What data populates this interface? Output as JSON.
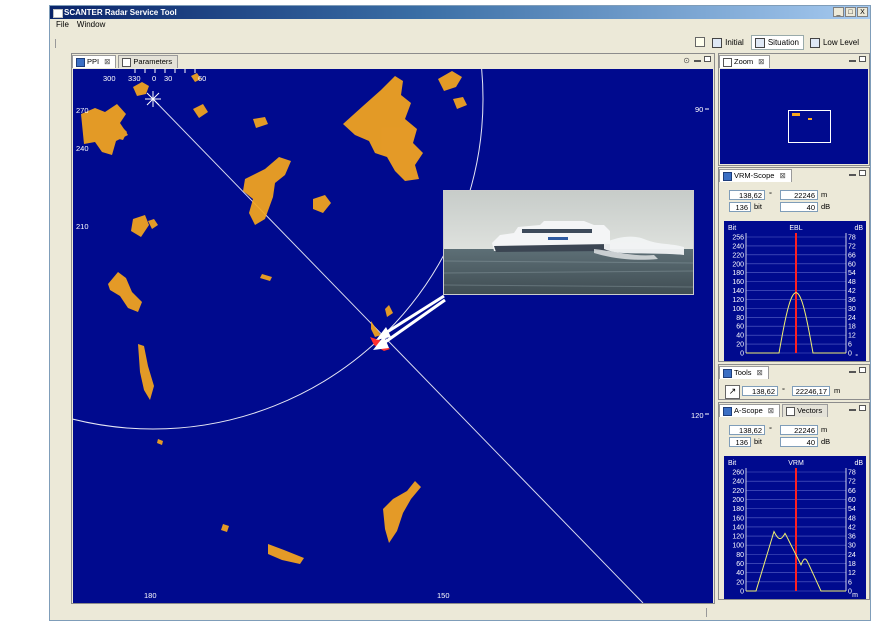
{
  "window": {
    "title": "SCANTER Radar Service Tool",
    "buttons": {
      "minimize": "_",
      "maximize": "□",
      "close": "X"
    }
  },
  "menu": [
    "File",
    "Window"
  ],
  "perspectives": [
    {
      "label": "Initial",
      "active": false
    },
    {
      "label": "Situation",
      "active": true
    },
    {
      "label": "Low Level",
      "active": false
    }
  ],
  "ppi": {
    "tabs": [
      {
        "label": "PPI",
        "close": "⊠"
      },
      {
        "label": "Parameters"
      }
    ],
    "bearing_labels": {
      "300": "300",
      "330": "330",
      "0": "0",
      "30": "30",
      "60": "60",
      "270": "270",
      "240": "240",
      "210": "210",
      "90": "90",
      "120": "120",
      "180": "180",
      "150": "150"
    },
    "corner_icon": "⊙"
  },
  "zoom": {
    "tab": "Zoom",
    "close": "⊠"
  },
  "vrm_scope": {
    "tab": "VRM-Scope",
    "close": "⊠",
    "bearing": "138,62",
    "bearing_unit": "°",
    "range": "22246",
    "range_unit": "m",
    "bit": "136",
    "bit_unit": "bit",
    "db": "40",
    "db_unit": "dB",
    "chart_title": "EBL",
    "left_label": "Bit",
    "right_label": "dB",
    "bottom_label": "°",
    "left_ticks": [
      "256",
      "240",
      "220",
      "200",
      "180",
      "160",
      "140",
      "120",
      "100",
      "80",
      "60",
      "40",
      "20",
      "0"
    ],
    "right_ticks": [
      "78",
      "72",
      "66",
      "60",
      "54",
      "48",
      "42",
      "36",
      "30",
      "24",
      "18",
      "12",
      "6",
      "0"
    ]
  },
  "tools": {
    "tab": "Tools",
    "close": "⊠",
    "bearing": "138,62",
    "bearing_unit": "°",
    "range": "22246,17",
    "range_unit": "m"
  },
  "a_scope": {
    "tab": "A-Scope",
    "close": "⊠",
    "tab2": "Vectors",
    "bearing": "138,62",
    "bearing_unit": "°",
    "range": "22246",
    "range_unit": "m",
    "bit": "136",
    "bit_unit": "bit",
    "db": "40",
    "db_unit": "dB",
    "chart_title": "VRM",
    "left_label": "Bit",
    "right_label": "dB",
    "bottom_label": "m",
    "left_ticks": [
      "260",
      "240",
      "220",
      "200",
      "180",
      "160",
      "140",
      "120",
      "100",
      "80",
      "60",
      "40",
      "20",
      "0"
    ],
    "right_ticks": [
      "78",
      "72",
      "66",
      "60",
      "54",
      "48",
      "42",
      "36",
      "30",
      "24",
      "18",
      "12",
      "6",
      "0"
    ]
  },
  "colors": {
    "radar_bg": "#000a8e",
    "echo": "#f7a71e",
    "marker": "#ff2020",
    "trace": "#f0f070"
  }
}
